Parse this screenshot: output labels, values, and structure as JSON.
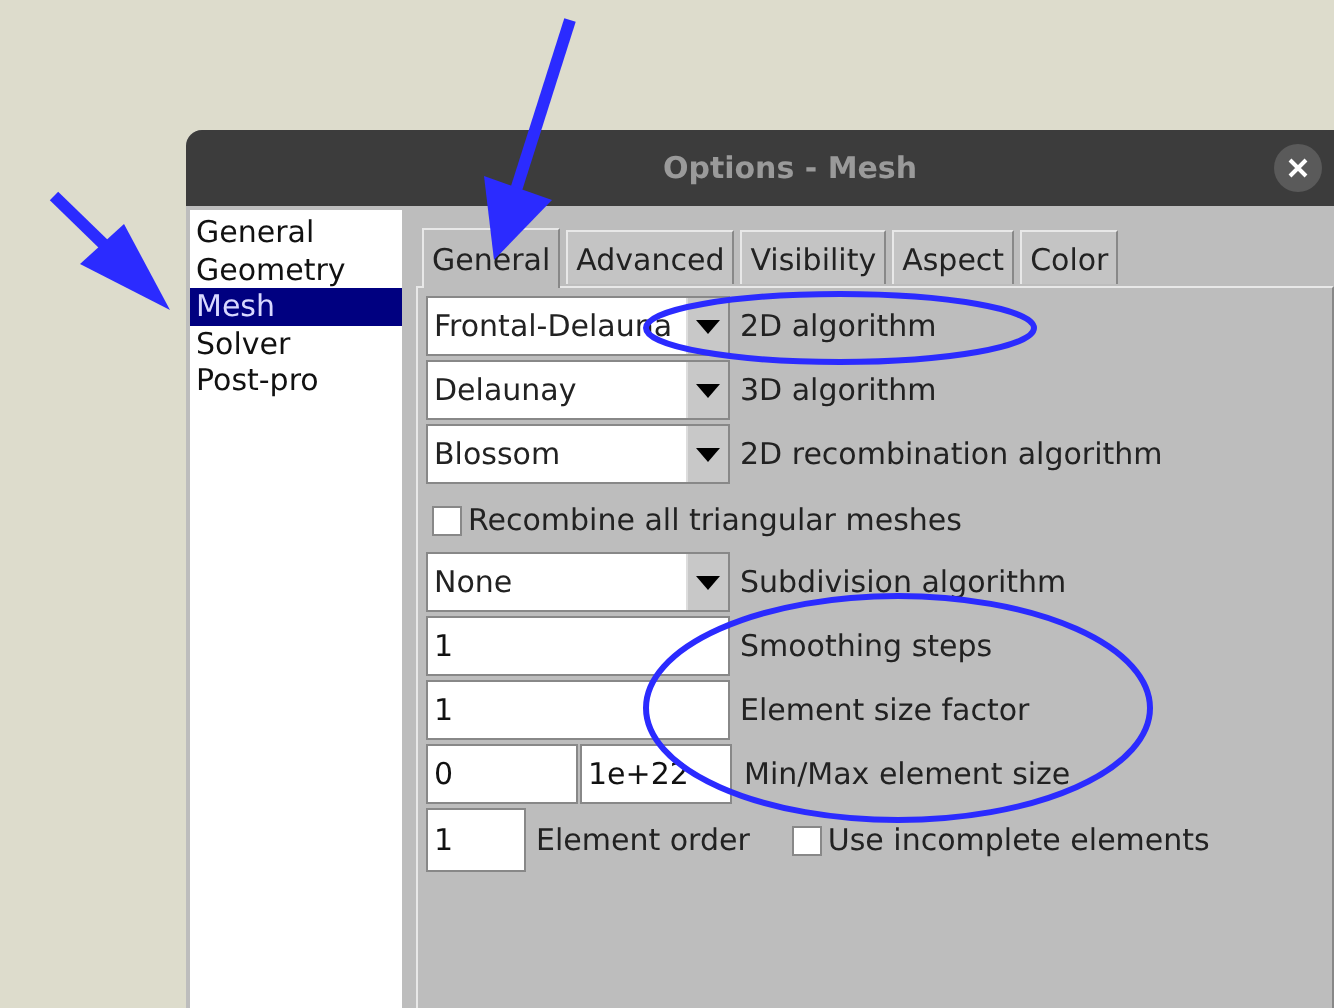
{
  "window": {
    "title": "Options - Mesh"
  },
  "sidebar": {
    "items": [
      {
        "label": "General",
        "selected": false
      },
      {
        "label": "Geometry",
        "selected": false
      },
      {
        "label": "Mesh",
        "selected": true
      },
      {
        "label": "Solver",
        "selected": false
      },
      {
        "label": "Post-pro",
        "selected": false
      }
    ]
  },
  "tabs": [
    {
      "label": "General",
      "selected": true
    },
    {
      "label": "Advanced",
      "selected": false
    },
    {
      "label": "Visibility",
      "selected": false
    },
    {
      "label": "Aspect",
      "selected": false
    },
    {
      "label": "Color",
      "selected": false
    }
  ],
  "rows": [
    {
      "kind": "dropdown",
      "value": "Frontal-Delauna",
      "label": "2D algorithm"
    },
    {
      "kind": "dropdown",
      "value": "Delaunay",
      "label": "3D algorithm"
    },
    {
      "kind": "dropdown",
      "value": "Blossom",
      "label": "2D recombination algorithm"
    },
    {
      "kind": "checkbox",
      "checked": false,
      "checkbox_label": "Recombine all triangular meshes"
    },
    {
      "kind": "dropdown",
      "value": "None",
      "label": "Subdivision algorithm"
    },
    {
      "kind": "input",
      "value": "1",
      "label": "Smoothing steps"
    },
    {
      "kind": "input",
      "value": "1",
      "label": "Element size factor"
    },
    {
      "kind": "pair",
      "values": [
        "0",
        "1e+22"
      ],
      "label": "Min/Max element size"
    },
    {
      "kind": "order",
      "value": "1",
      "label": "Element order",
      "checkbox_label": "Use incomplete elements",
      "checked": false
    }
  ]
}
